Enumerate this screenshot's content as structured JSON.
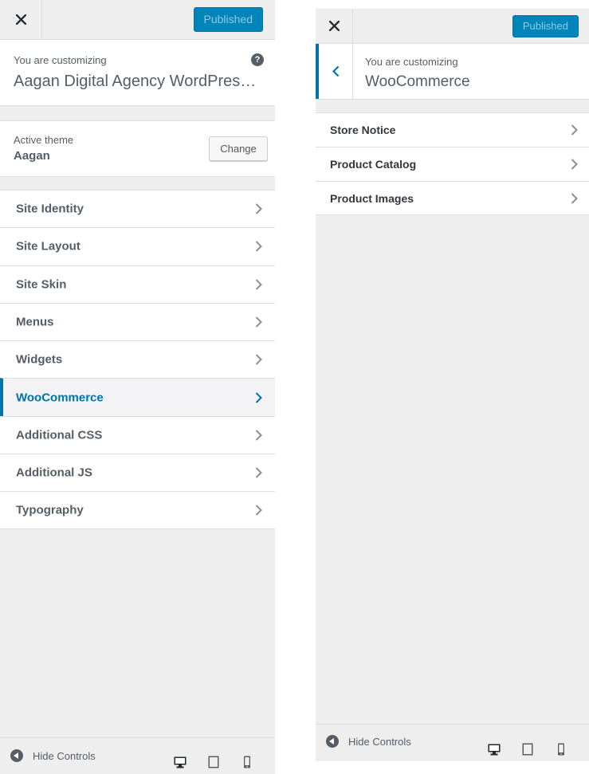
{
  "left_panel": {
    "header": {
      "publish_label": "Published"
    },
    "info": {
      "label": "You are customizing",
      "site_title": "Aagan Digital Agency WordPres…",
      "help_symbol": "?"
    },
    "theme": {
      "label": "Active theme",
      "name": "Aagan",
      "change_label": "Change"
    },
    "sections": [
      {
        "label": "Site Identity"
      },
      {
        "label": "Site Layout"
      },
      {
        "label": "Site Skin"
      },
      {
        "label": "Menus"
      },
      {
        "label": "Widgets"
      },
      {
        "label": "WooCommerce",
        "active": true
      },
      {
        "label": "Additional CSS"
      },
      {
        "label": "Additional JS"
      },
      {
        "label": "Typography"
      }
    ],
    "footer": {
      "hide_label": "Hide Controls"
    }
  },
  "right_panel": {
    "header": {
      "publish_label": "Published"
    },
    "sub_header": {
      "label": "You are customizing",
      "section_title": "WooCommerce"
    },
    "sections": [
      {
        "label": "Store Notice"
      },
      {
        "label": "Product Catalog"
      },
      {
        "label": "Product Images"
      }
    ],
    "footer": {
      "hide_label": "Hide Controls"
    }
  },
  "colors": {
    "accent": "#0073aa",
    "publish_button": "#0085ba",
    "panel_background": "#eeeeee",
    "text": "#555d66"
  },
  "icons": [
    "close-icon",
    "help-icon",
    "chevron-right-icon",
    "chevron-left-icon",
    "collapse-icon",
    "desktop-icon",
    "tablet-icon",
    "mobile-icon"
  ]
}
